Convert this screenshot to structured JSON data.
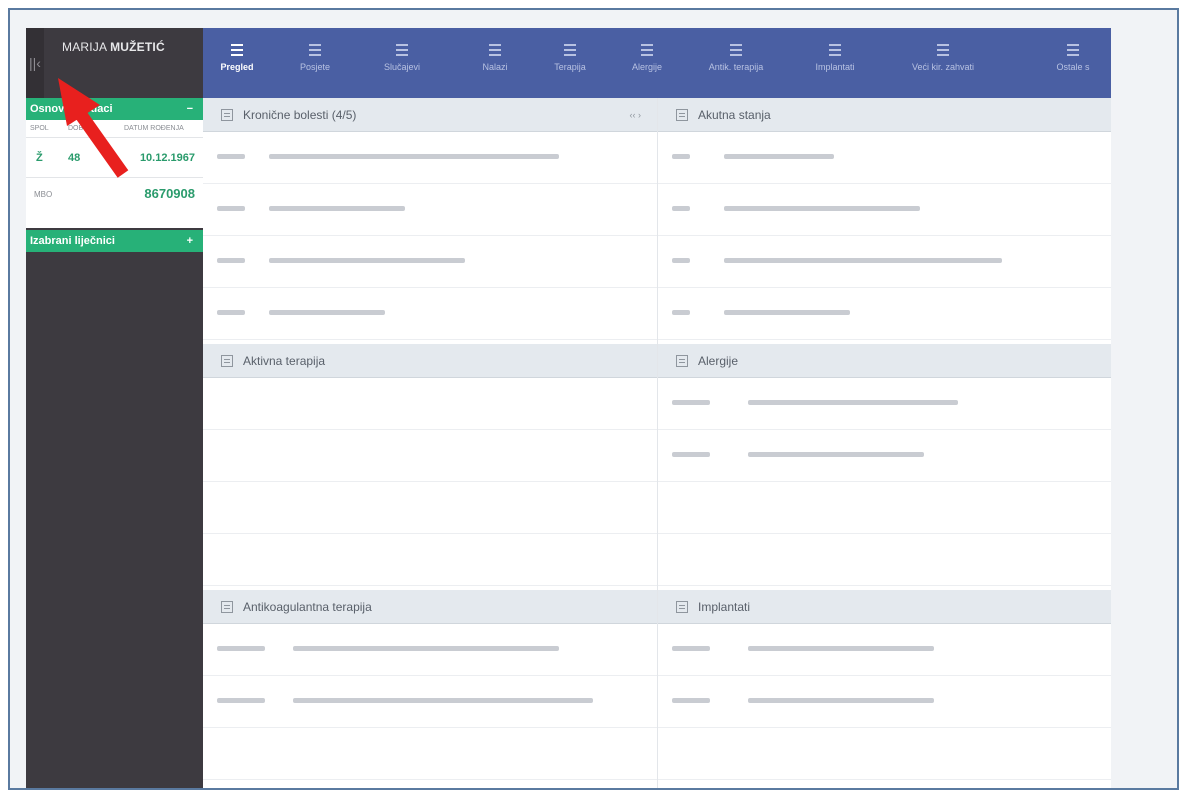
{
  "patient": {
    "first_name": "MARIJA",
    "last_name": "MUŽETIĆ"
  },
  "sidebar": {
    "collapse_glyph": "||‹",
    "basic_section": {
      "label": "Osnovni podaci",
      "toggle": "−"
    },
    "info_headers": {
      "sex": "SPOL",
      "age": "DOB",
      "dob": "DATUM ROĐENJA"
    },
    "info_values": {
      "sex": "Ž",
      "age": "48",
      "dob": "10.12.1967"
    },
    "mbo": {
      "label": "MBO",
      "value": "8670908"
    },
    "doctors_section": {
      "label": "Izabrani liječnici",
      "toggle": "+"
    }
  },
  "nav": {
    "items": [
      {
        "label": "Pregled",
        "active": true,
        "icon": "list-icon"
      },
      {
        "label": "Posjete",
        "active": false,
        "icon": "list-icon"
      },
      {
        "label": "Slučajevi",
        "active": false,
        "icon": "list-icon"
      },
      {
        "label": "Nalazi",
        "active": false,
        "icon": "list-icon"
      },
      {
        "label": "Terapija",
        "active": false,
        "icon": "list-icon"
      },
      {
        "label": "Alergije",
        "active": false,
        "icon": "list-icon"
      },
      {
        "label": "Antik. terapija",
        "active": false,
        "icon": "list-icon"
      },
      {
        "label": "Implantati",
        "active": false,
        "icon": "list-icon"
      },
      {
        "label": "Veći kir. zahvati",
        "active": false,
        "icon": "list-icon"
      },
      {
        "label": "Ostale s",
        "active": false,
        "icon": "list-icon"
      }
    ]
  },
  "panels": {
    "chronic": {
      "title": "Kronične bolesti (4/5)",
      "pagination": "‹‹ ›"
    },
    "acute": {
      "title": "Akutna stanja"
    },
    "therapy": {
      "title": "Aktivna terapija"
    },
    "allergies": {
      "title": "Alergije"
    },
    "anticoag": {
      "title": "Antikoagulantna terapija"
    },
    "implants": {
      "title": "Implantati"
    }
  },
  "colors": {
    "nav_bg": "#4a5fa3",
    "sidebar_bg": "#3d3a40",
    "accent_green": "#27b178",
    "annotation_arrow": "#e8201e"
  }
}
